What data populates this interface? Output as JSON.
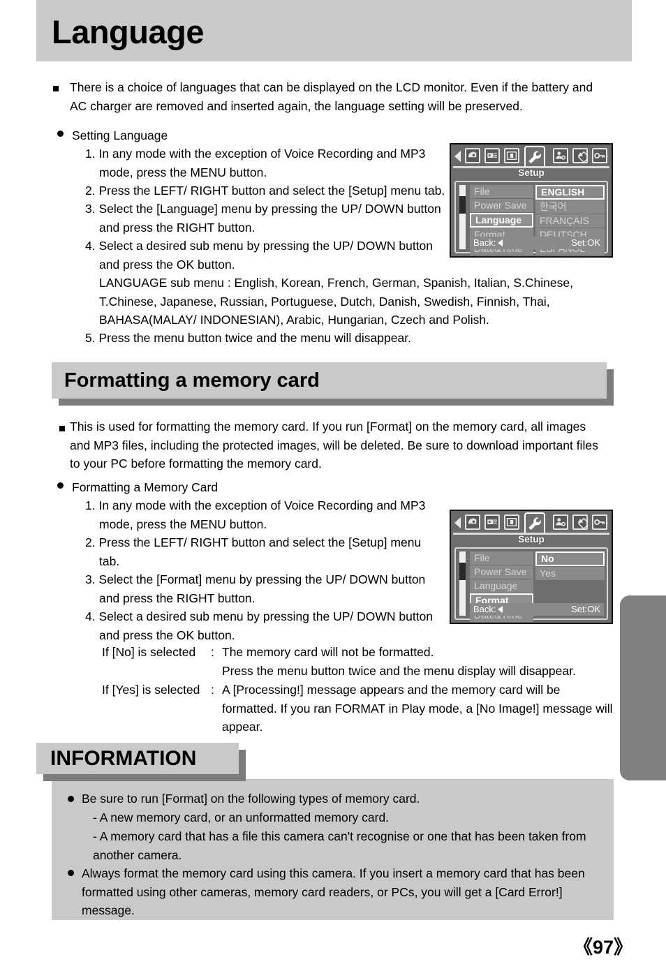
{
  "page": {
    "number": "《97》",
    "colors": {
      "banner_gray": "#c9c9c9",
      "shadow_gray": "#7c7c7c",
      "tab_gray": "#808080"
    }
  },
  "section_language": {
    "title": "Language",
    "intro": "There is a choice of languages that can be displayed on the LCD monitor. Even if the battery and AC charger are removed and inserted again, the language setting will be preserved.",
    "sub_heading": "Setting Language",
    "steps": [
      "1. In any mode with the exception of Voice Recording and MP3 mode, press the MENU button.",
      "2. Press the LEFT/ RIGHT button and select the [Setup] menu tab.",
      "3. Select the [Language] menu by pressing the UP/ DOWN button and press the RIGHT button.",
      "4. Select a desired sub menu by pressing the UP/ DOWN button and press the OK button.",
      "5. Press the menu button twice and the menu will disappear."
    ],
    "sub_menu_note": "LANGUAGE sub menu : English, Korean, French, German, Spanish, Italian, S.Chinese, T.Chinese, Japanese, Russian, Portuguese, Dutch, Danish, Swedish, Finnish, Thai, BAHASA(MALAY/ INDONESIAN), Arabic, Hungarian, Czech and Polish."
  },
  "section_format": {
    "title": "Formatting a memory card",
    "intro": "This is used for formatting the memory card. If you run [Format] on the memory card, all images and MP3 files, including the protected images, will be deleted. Be sure to download important files to your PC before formatting the memory card.",
    "sub_heading": "Formatting a Memory Card",
    "steps": [
      "1. In any mode with the exception of Voice Recording and MP3 mode, press the MENU button.",
      "2. Press the LEFT/ RIGHT button and select the [Setup] menu tab.",
      "3. Select the [Format] menu by pressing the UP/ DOWN button and press the RIGHT button.",
      "4. Select a desired sub menu by pressing the UP/ DOWN button and press the OK button."
    ],
    "outcomes": [
      {
        "label": "If [No] is selected",
        "sep": ":",
        "text": "The memory card will not be formatted."
      },
      {
        "label": "",
        "sep": "",
        "text": "Press the menu button twice and the menu display will disappear."
      },
      {
        "label": "If [Yes] is selected",
        "sep": ":",
        "text": "A [Processing!] message appears and the memory card will be formatted. If you ran FORMAT in Play mode, a [No Image!] message will appear."
      }
    ]
  },
  "section_information": {
    "title": "INFORMATION",
    "items": [
      "Be sure to run [Format] on the following types of memory card.",
      "- A new memory card, or an unformatted memory card.",
      "- A memory card that has a file this camera can't recognise or one that has been taken from another camera.",
      "Always format the memory card using this camera. If you insert a memory card that has been formatted using other cameras, memory card readers, or PCs, you will get a [Card Error!] message."
    ]
  },
  "lcd_language": {
    "tab_title": "Setup",
    "tabs": [
      "recording-mode-icon",
      "movie-clip-icon",
      "display-icon",
      "setup-wrench-icon",
      "my-camera-icon",
      "effect-icon",
      "key-icon"
    ],
    "menu_items": [
      "File",
      "Power Save",
      "Language",
      "Format",
      "Date&Time"
    ],
    "selected_menu": "Language",
    "options": [
      "ENGLISH",
      "한국어",
      "FRANÇAIS",
      "DEUTSCH",
      "ESPAÑOL"
    ],
    "selected_option": "ENGLISH",
    "footer_back": "Back:",
    "footer_set": "Set:OK"
  },
  "lcd_format": {
    "tab_title": "Setup",
    "tabs": [
      "recording-mode-icon",
      "movie-clip-icon",
      "display-icon",
      "setup-wrench-icon",
      "my-camera-icon",
      "effect-icon",
      "key-icon"
    ],
    "menu_items": [
      "File",
      "Power Save",
      "Language",
      "Format",
      "Date&Time"
    ],
    "selected_menu": "Format",
    "options": [
      "No",
      "Yes"
    ],
    "selected_option": "No",
    "footer_back": "Back:",
    "footer_set": "Set:OK"
  }
}
